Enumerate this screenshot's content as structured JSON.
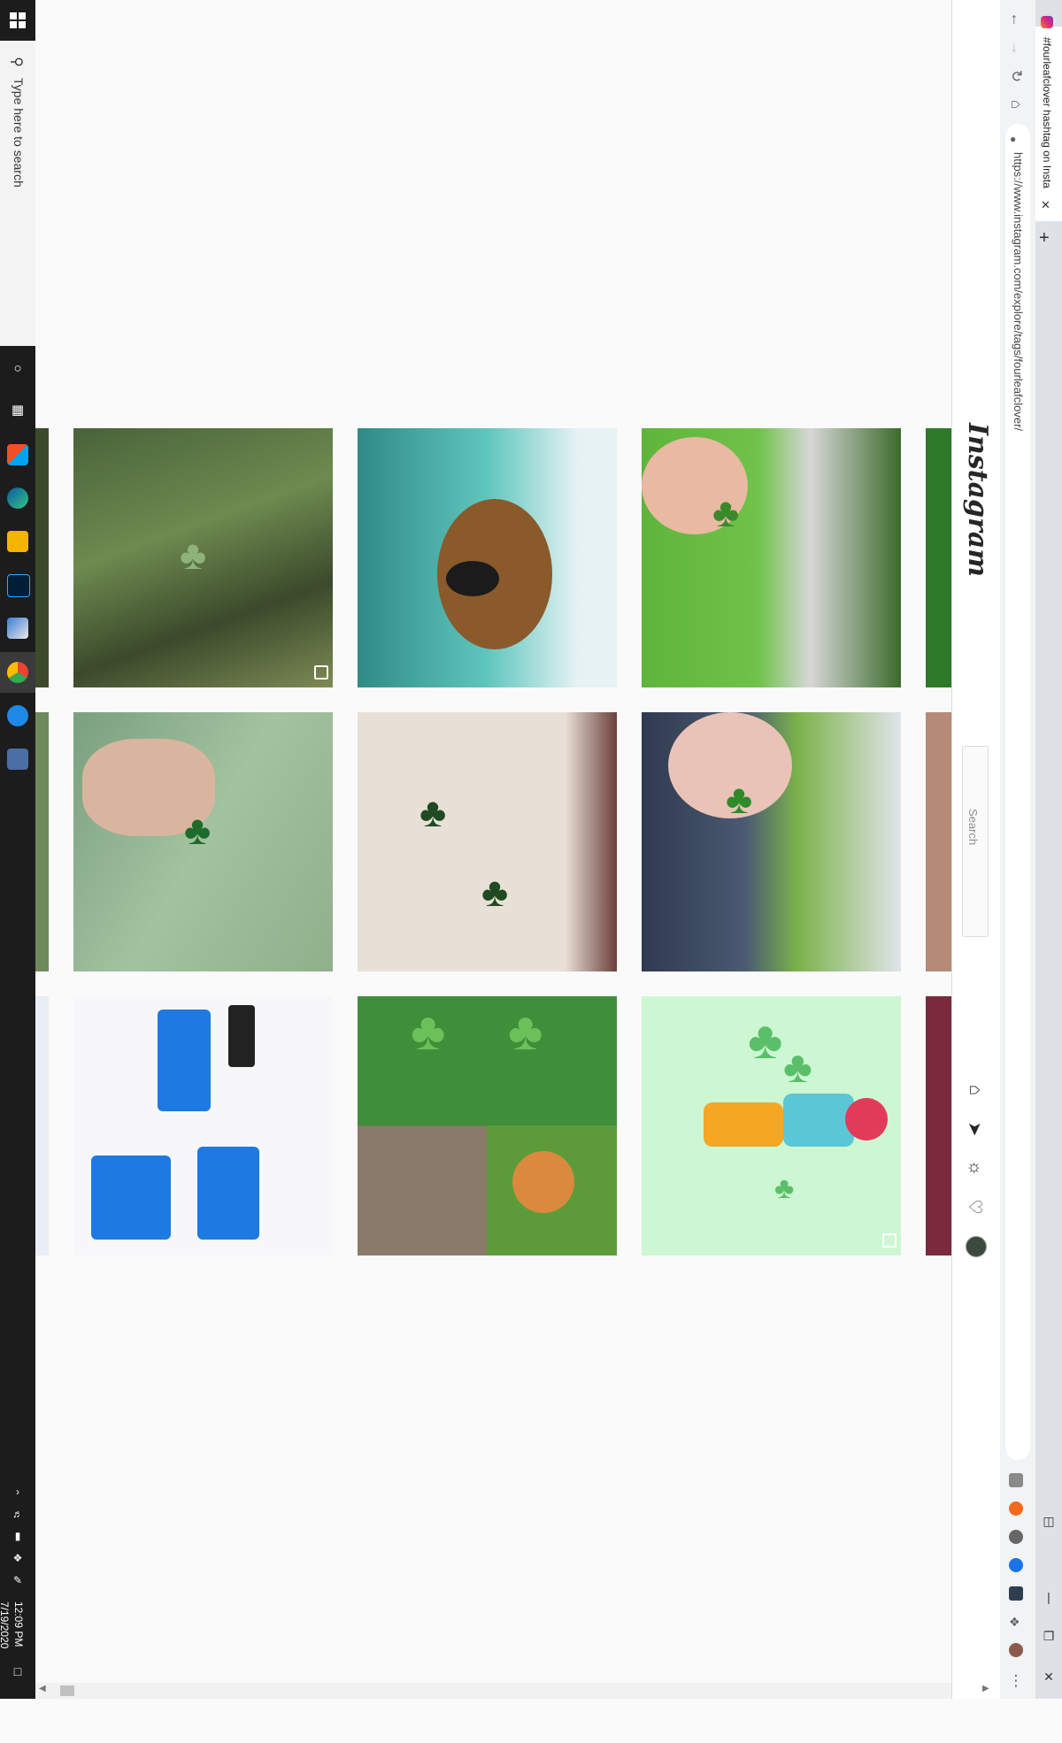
{
  "taskbar": {
    "search_placeholder": "Type here to search",
    "clock_time": "12:09 PM",
    "clock_date": "7/19/2020"
  },
  "browser": {
    "tab_title": "#fourleafclover hashtag on Insta",
    "url": "https://www.instagram.com/explore/tags/fourleafclover/"
  },
  "instagram": {
    "logo_text": "Instagram",
    "search_placeholder": "Search",
    "nav_icons": [
      "home-icon",
      "direct-icon",
      "explore-icon",
      "activity-heart-icon",
      "profile-avatar"
    ]
  },
  "grid": {
    "rows": [
      [
        "clover-in-grass",
        "dog-in-clovers",
        "hand-holding-clover"
      ],
      [
        "hand-with-ring-clover",
        "two-clovers-on-table",
        "clover-with-dog"
      ],
      [
        "chat-screenshot-clover-rings",
        "clovers-and-cats-collage",
        "clover-illustration"
      ]
    ]
  },
  "colors": {
    "taskbar": "#1c1c1c",
    "ig_background": "#fafafa",
    "chrome_bar": "#f1f3f4",
    "tab_strip": "#dee1e6"
  }
}
